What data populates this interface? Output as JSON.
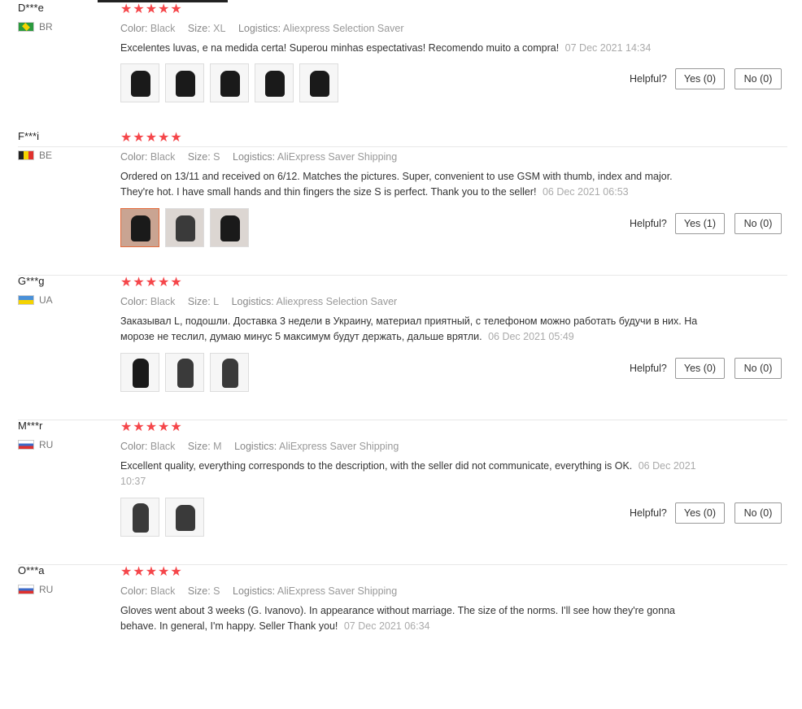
{
  "reviews": [
    {
      "user": "D***e",
      "country": "BR",
      "flag_colors": [
        "#2b9a3e",
        "#f5d300"
      ],
      "rating": 5,
      "color_label": "Color:",
      "color": "Black",
      "size_label": "Size:",
      "size": "XL",
      "logistics_label": "Logistics:",
      "logistics": "Aliexpress Selection Saver",
      "text": "Excelentes luvas, e na medida certa! Superou minhas espectativas! Recomendo muito a compra!",
      "date": "07 Dec 2021 14:34",
      "photos": 5,
      "helpful_label": "Helpful?",
      "yes_label": "Yes (0)",
      "no_label": "No (0)"
    },
    {
      "user": "F***i",
      "country": "BE",
      "flag_colors": [
        "#222222",
        "#f5d300",
        "#e0312e"
      ],
      "rating": 5,
      "color_label": "Color:",
      "color": "Black",
      "size_label": "Size:",
      "size": "S",
      "logistics_label": "Logistics:",
      "logistics": "AliExpress Saver Shipping",
      "text": "Ordered on 13/11 and received on 6/12. Matches the pictures. Super, convenient to use GSM with thumb, index and major. They're hot. I have small hands and thin fingers the size S is perfect. Thank you to the seller!",
      "date": "06 Dec 2021 06:53",
      "photos": 3,
      "helpful_label": "Helpful?",
      "yes_label": "Yes (1)",
      "no_label": "No (0)"
    },
    {
      "user": "G***g",
      "country": "UA",
      "flag_colors": [
        "#4a90d9",
        "#f5d300"
      ],
      "rating": 5,
      "color_label": "Color:",
      "color": "Black",
      "size_label": "Size:",
      "size": "L",
      "logistics_label": "Logistics:",
      "logistics": "Aliexpress Selection Saver",
      "text": "Заказывал L, подошли. Доставка 3 недели в Украину, материал приятный, с телефоном можно работать будучи в них. На морозе не теслил, думаю минус 5 максимум будут держать, дальше врятли.",
      "date": "06 Dec 2021 05:49",
      "photos": 3,
      "helpful_label": "Helpful?",
      "yes_label": "Yes (0)",
      "no_label": "No (0)"
    },
    {
      "user": "M***r",
      "country": "RU",
      "flag_colors": [
        "#ffffff",
        "#3b6ac8",
        "#e0312e"
      ],
      "rating": 5,
      "color_label": "Color:",
      "color": "Black",
      "size_label": "Size:",
      "size": "M",
      "logistics_label": "Logistics:",
      "logistics": "AliExpress Saver Shipping",
      "text": "Excellent quality, everything corresponds to the description, with the seller did not communicate, everything is OK.",
      "date": "06 Dec 2021 10:37",
      "photos": 2,
      "helpful_label": "Helpful?",
      "yes_label": "Yes (0)",
      "no_label": "No (0)"
    },
    {
      "user": "O***a",
      "country": "RU",
      "flag_colors": [
        "#ffffff",
        "#3b6ac8",
        "#e0312e"
      ],
      "rating": 5,
      "color_label": "Color:",
      "color": "Black",
      "size_label": "Size:",
      "size": "S",
      "logistics_label": "Logistics:",
      "logistics": "AliExpress Saver Shipping",
      "text": "Gloves went about 3 weeks (G. Ivanovo). In appearance without marriage. The size of the norms. I'll see how they're gonna behave. In general, I'm happy. Seller Thank you!",
      "date": "07 Dec 2021 06:34",
      "photos": 0,
      "helpful_label": "Helpful?",
      "yes_label": "Yes (0)",
      "no_label": "No (0)"
    }
  ],
  "colors": {
    "star": "#f5464a",
    "date": "#aaaaaa",
    "meta": "#999999",
    "selected_photo_border": "#e56a3a"
  },
  "icons": {
    "star": "star-icon",
    "flag": "flag-icon"
  }
}
